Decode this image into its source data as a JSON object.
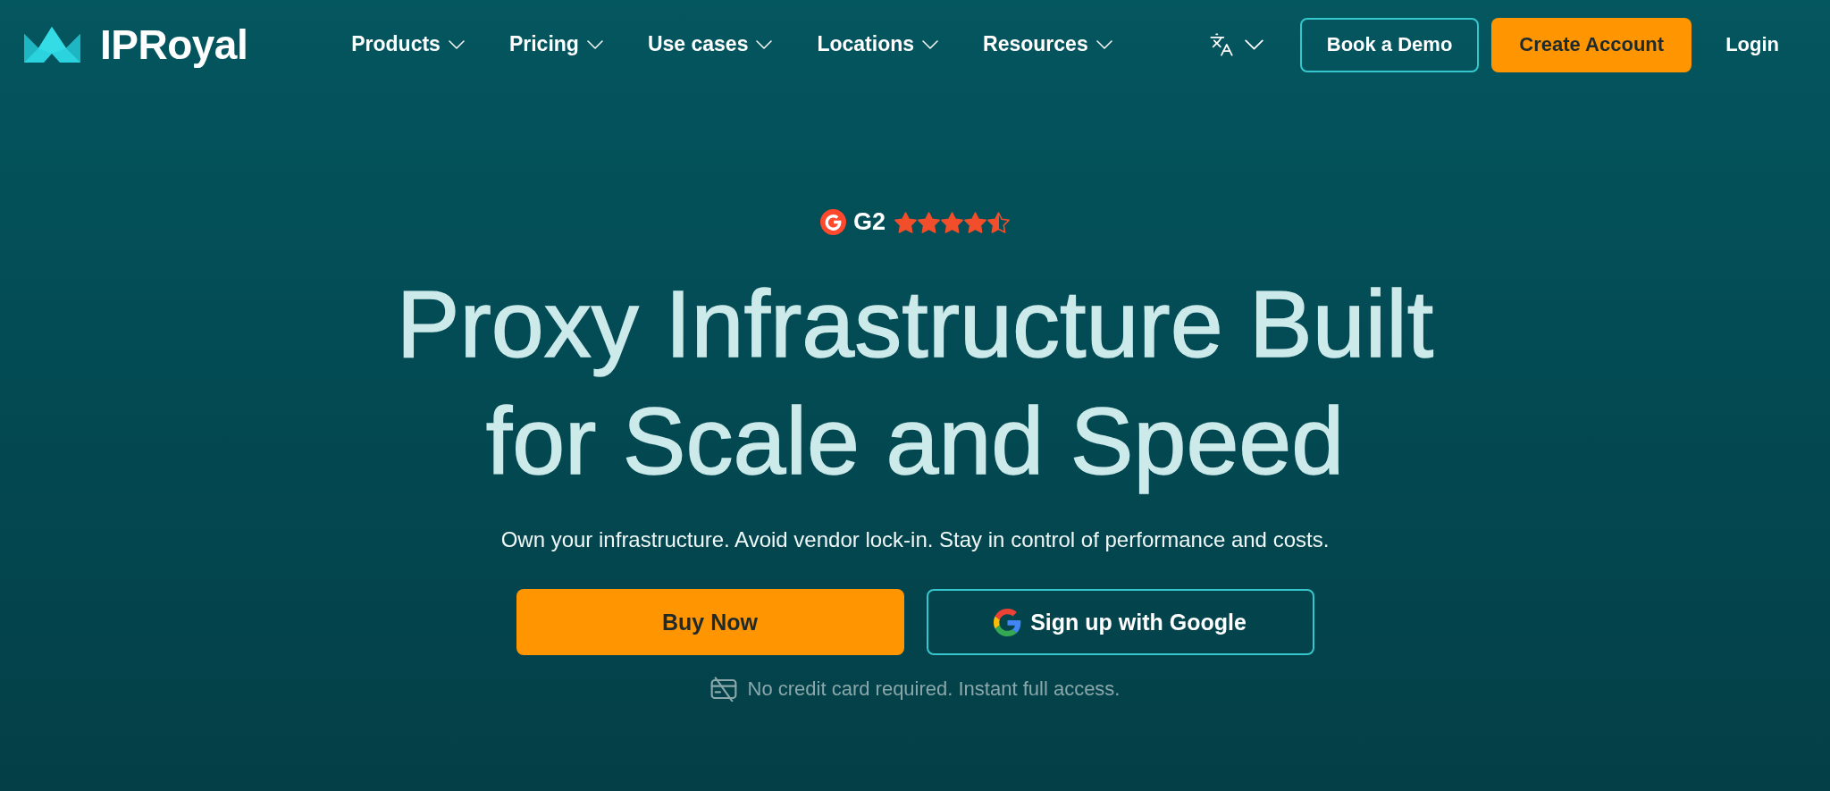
{
  "header": {
    "logo": {
      "text": "IPRoyal"
    },
    "nav": [
      {
        "label": "Products",
        "dropdown": true
      },
      {
        "label": "Pricing",
        "dropdown": true
      },
      {
        "label": "Use cases",
        "dropdown": true
      },
      {
        "label": "Locations",
        "dropdown": true
      },
      {
        "label": "Resources",
        "dropdown": true
      }
    ],
    "actions": [
      {
        "kind": "outline",
        "label": "Book a Demo"
      },
      {
        "kind": "primary",
        "label": "Create Account"
      },
      {
        "kind": "link",
        "label": "Login"
      }
    ]
  },
  "hero": {
    "rating": {
      "label": "G2",
      "stars": 4.5
    },
    "title": "Proxy Infrastructure Built for Scale and Speed",
    "subtitle": "Own your infrastructure. Avoid vendor lock-in. Stay in control of performance and costs.",
    "buttons": [
      {
        "kind": "primary",
        "label": "Buy Now"
      },
      {
        "kind": "google",
        "label": "Sign up with Google"
      }
    ],
    "note": "No credit card required. Instant full access."
  }
}
